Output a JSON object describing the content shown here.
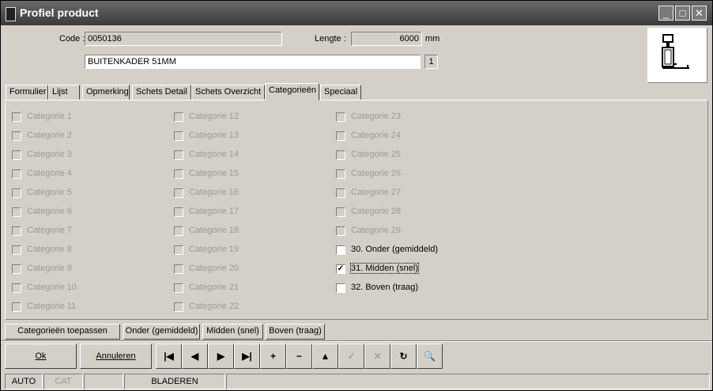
{
  "window": {
    "title": "Profiel product"
  },
  "form": {
    "code_label": "Code :",
    "code_value": "0050136",
    "lengte_label": "Lengte :",
    "lengte_value": "6000",
    "lengte_unit": "mm",
    "description": "BUITENKADER 51MM",
    "counter": "1"
  },
  "tabs": [
    "Formulier",
    "Lijst",
    "Opmerking",
    "Schets Detail",
    "Schets Overzicht",
    "Categorieën",
    "Speciaal"
  ],
  "active_tab": "Categorieën",
  "categories": {
    "col1": [
      {
        "label": "Categorie 1",
        "enabled": false,
        "checked": false
      },
      {
        "label": "Categorie 2",
        "enabled": false,
        "checked": false
      },
      {
        "label": "Categorie 3",
        "enabled": false,
        "checked": false
      },
      {
        "label": "Categorie 4",
        "enabled": false,
        "checked": false
      },
      {
        "label": "Categorie 5",
        "enabled": false,
        "checked": false
      },
      {
        "label": "Categorie 6",
        "enabled": false,
        "checked": false
      },
      {
        "label": "Categorie 7",
        "enabled": false,
        "checked": false
      },
      {
        "label": "Categorie 8",
        "enabled": false,
        "checked": false
      },
      {
        "label": "Categorie 9",
        "enabled": false,
        "checked": false
      },
      {
        "label": "Categorie 10",
        "enabled": false,
        "checked": false
      },
      {
        "label": "Categorie 11",
        "enabled": false,
        "checked": false
      }
    ],
    "col2": [
      {
        "label": "Categorie 12",
        "enabled": false,
        "checked": false
      },
      {
        "label": "Categorie 13",
        "enabled": false,
        "checked": false
      },
      {
        "label": "Categorie 14",
        "enabled": false,
        "checked": false
      },
      {
        "label": "Categorie 15",
        "enabled": false,
        "checked": false
      },
      {
        "label": "Categorie 16",
        "enabled": false,
        "checked": false
      },
      {
        "label": "Categorie 17",
        "enabled": false,
        "checked": false
      },
      {
        "label": "Categorie 18",
        "enabled": false,
        "checked": false
      },
      {
        "label": "Categorie 19",
        "enabled": false,
        "checked": false
      },
      {
        "label": "Categorie 20",
        "enabled": false,
        "checked": false
      },
      {
        "label": "Categorie 21",
        "enabled": false,
        "checked": false
      },
      {
        "label": "Categorie 22",
        "enabled": false,
        "checked": false
      }
    ],
    "col3": [
      {
        "label": "Categorie 23",
        "enabled": false,
        "checked": false
      },
      {
        "label": "Categorie 24",
        "enabled": false,
        "checked": false
      },
      {
        "label": "Categorie 25",
        "enabled": false,
        "checked": false
      },
      {
        "label": "Categorie 26",
        "enabled": false,
        "checked": false
      },
      {
        "label": "Categorie 27",
        "enabled": false,
        "checked": false
      },
      {
        "label": "Categorie 28",
        "enabled": false,
        "checked": false
      },
      {
        "label": "Categorie 29",
        "enabled": false,
        "checked": false
      },
      {
        "label": "30. Onder (gemiddeld)",
        "enabled": true,
        "checked": false
      },
      {
        "label": "31. Midden (snel)",
        "enabled": true,
        "checked": true
      },
      {
        "label": "32. Boven (traag)",
        "enabled": true,
        "checked": false
      }
    ]
  },
  "action_buttons": [
    "Categorieën toepassen",
    "Onder (gemiddeld)",
    "Midden (snel)",
    "Boven (traag)"
  ],
  "ok_label": "Ok",
  "cancel_label": "Annuleren",
  "nav_buttons": [
    {
      "name": "first-record-button",
      "glyph": "|◀",
      "enabled": true
    },
    {
      "name": "prev-record-button",
      "glyph": "◀",
      "enabled": true
    },
    {
      "name": "next-record-button",
      "glyph": "▶",
      "enabled": true
    },
    {
      "name": "last-record-button",
      "glyph": "▶|",
      "enabled": true
    },
    {
      "name": "add-record-button",
      "glyph": "+",
      "enabled": true
    },
    {
      "name": "delete-record-button",
      "glyph": "−",
      "enabled": true
    },
    {
      "name": "edit-record-button",
      "glyph": "▲",
      "enabled": true
    },
    {
      "name": "post-record-button",
      "glyph": "✓",
      "enabled": false
    },
    {
      "name": "cancel-edit-button",
      "glyph": "✕",
      "enabled": false
    },
    {
      "name": "refresh-button",
      "glyph": "↻",
      "enabled": true
    },
    {
      "name": "search-button",
      "glyph": "🔍",
      "enabled": true
    }
  ],
  "status": [
    "AUTO",
    "CAT",
    "",
    "BLADEREN",
    ""
  ]
}
